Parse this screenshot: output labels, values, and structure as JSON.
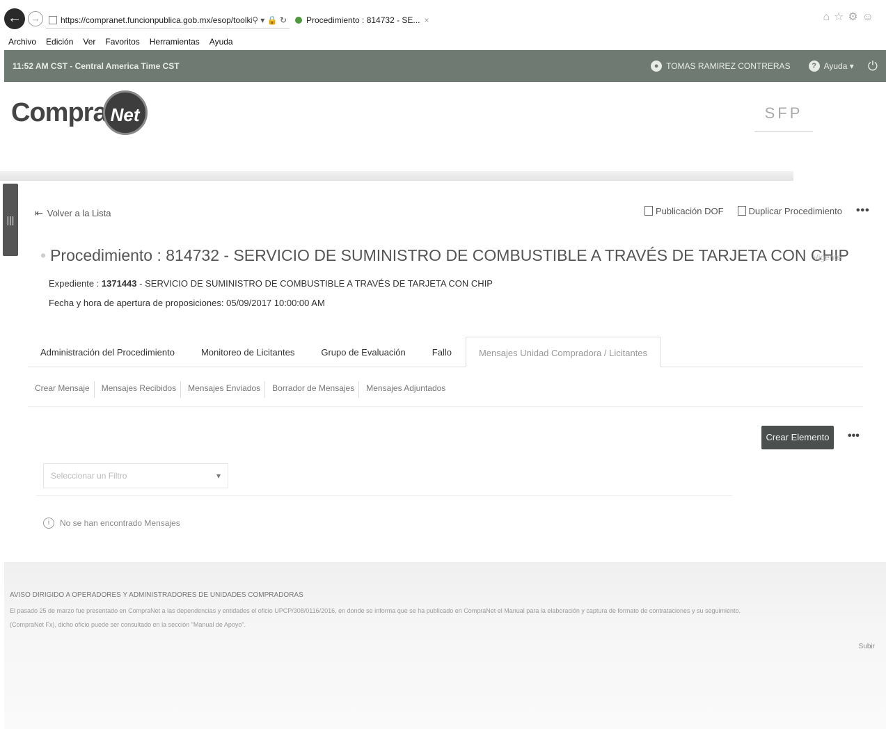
{
  "browser": {
    "url": "https://compranet.funcionpublica.gob.mx/esop/toolkit/...",
    "tab_title": "Procedimiento : 814732 - SE...",
    "tab_close": "×",
    "address_tools": "⚲ ▾ 🔒 ↻"
  },
  "menu": [
    "Archivo",
    "Edición",
    "Ver",
    "Favoritos",
    "Herramientas",
    "Ayuda"
  ],
  "topstrip": {
    "time": "11:52 AM CST - Central America Time CST",
    "user": "TOMAS RAMIREZ CONTRERAS",
    "help": "Ayuda ▾"
  },
  "header": {
    "logo_text": "Compra",
    "logo_globe": "Net",
    "sfp": "SFP"
  },
  "toolbar": {
    "back": "Volver a la Lista",
    "publicacion": "Publicación DOF",
    "duplicar": "Duplicar Procedimiento",
    "more": "•••"
  },
  "procedure": {
    "title": "Procedimiento : 814732 - SERVICIO DE SUMINISTRO DE COMBUSTIBLE A TRAVÉS DE TARJETA CON CHIP",
    "status": "Vigente",
    "expediente_label": "Expediente :",
    "expediente_number": "1371443",
    "expediente_desc": "- SERVICIO DE SUMINISTRO DE COMBUSTIBLE A TRAVÉS DE TARJETA CON CHIP",
    "apertura": "Fecha y hora de apertura de proposiciones: 05/09/2017 10:00:00 AM"
  },
  "tabs": [
    {
      "label": "Administración del Procedimiento",
      "active": false
    },
    {
      "label": "Monitoreo de Licitantes",
      "active": false
    },
    {
      "label": "Grupo de Evaluación",
      "active": false
    },
    {
      "label": "Fallo",
      "active": false
    },
    {
      "label": "Mensajes Unidad Compradora / Licitantes",
      "active": true
    }
  ],
  "subtabs": [
    "Crear Mensaje",
    "Mensajes Recibidos",
    "Mensajes Enviados",
    "Borrador de Mensajes",
    "Mensajes Adjuntados"
  ],
  "actions": {
    "create": "Crear Elemento",
    "more": "•••"
  },
  "filter": {
    "placeholder": "Seleccionar un Filtro"
  },
  "empty": {
    "message": "No se han encontrado Mensajes"
  },
  "footer": {
    "notice_title": "AVISO DIRIGIDO A OPERADORES Y ADMINISTRADORES DE UNIDADES COMPRADORAS",
    "notice_line1": "El pasado 25 de marzo fue presentado en CompraNet a las dependencias y entidades el oficio UPCP/308/0116/2016, en donde se informa que se ha publicado en CompraNet el Manual para la elaboración y captura de formato de contrataciones y su seguimiento.",
    "notice_line2": "(CompraNet Fx), dicho oficio puede ser consultado en la sección \"Manual de Apoyo\".",
    "up": "Subir"
  },
  "colors": {
    "topstrip": "#6f7a73",
    "button": "#4b504e"
  }
}
